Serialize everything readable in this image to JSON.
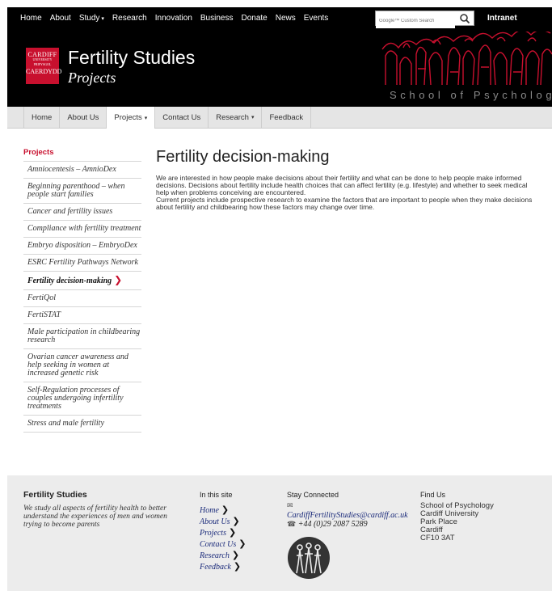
{
  "topnav": {
    "items": [
      "Home",
      "About",
      "Study",
      "Research",
      "Innovation",
      "Business",
      "Donate",
      "News",
      "Events"
    ],
    "study_caret": "▾",
    "search_placeholder": "Google™ Custom Search",
    "intranet": "Intranet"
  },
  "header": {
    "logo_line1": "CARDIFF",
    "logo_line2": "UNIVERSITY",
    "logo_line3": "PRIFYSGOL",
    "logo_line4": "CAERDYDD",
    "title": "Fertility Studies",
    "subtitle": "Projects",
    "school": "School of Psychology"
  },
  "subnav": {
    "items": [
      "Home",
      "About Us",
      "Projects",
      "Contact Us",
      "Research",
      "Feedback"
    ],
    "caret": "▾"
  },
  "sidebar": {
    "heading": "Projects",
    "items": [
      "Amniocentesis – AmnioDex",
      "Beginning parenthood – when people start families",
      "Cancer and fertility issues",
      "Compliance with fertility treatment",
      "Embryo disposition – EmbryoDex",
      "ESRC Fertility Pathways Network",
      "Fertility decision-making",
      "FertiQol",
      "FertiSTAT",
      "Male participation in childbearing research",
      "Ovarian cancer awareness and help seeking in women at increased genetic risk",
      "Self-Regulation processes of couples undergoing infertility treatments",
      "Stress and male fertility"
    ],
    "active_arrow": "❯"
  },
  "main": {
    "title": "Fertility decision-making",
    "para1": "We are interested in how people make decisions about their fertility and what can be done to help people make informed decisions. Decisions about fertility include health choices that can affect fertility (e.g. lifestyle) and whether to seek medical help when problems conceiving are encountered.",
    "para2": "Current projects include prospective research to examine the factors that are important to people when they make decisions about fertility and childbearing how these factors may change over time."
  },
  "footer": {
    "col1_title": "Fertility Studies",
    "col1_text": "We study all aspects of fertility health to better understand the experiences of men and women trying to become parents",
    "col2_head": "In this site",
    "col2_links": [
      "Home",
      "About Us",
      "Projects",
      "Contact Us",
      "Research",
      "Feedback"
    ],
    "link_arrow": "❯",
    "col3_head": "Stay Connected",
    "email_icon": "✉",
    "email": "CardiffFertilityStudies@cardiff.ac.uk",
    "phone_icon": "☎",
    "phone": "+44 (0)29 2087 5289",
    "col4_head": "Find Us",
    "address": [
      "School of Psychology",
      "Cardiff University",
      "Park Place",
      "Cardiff",
      "CF10 3AT"
    ]
  }
}
